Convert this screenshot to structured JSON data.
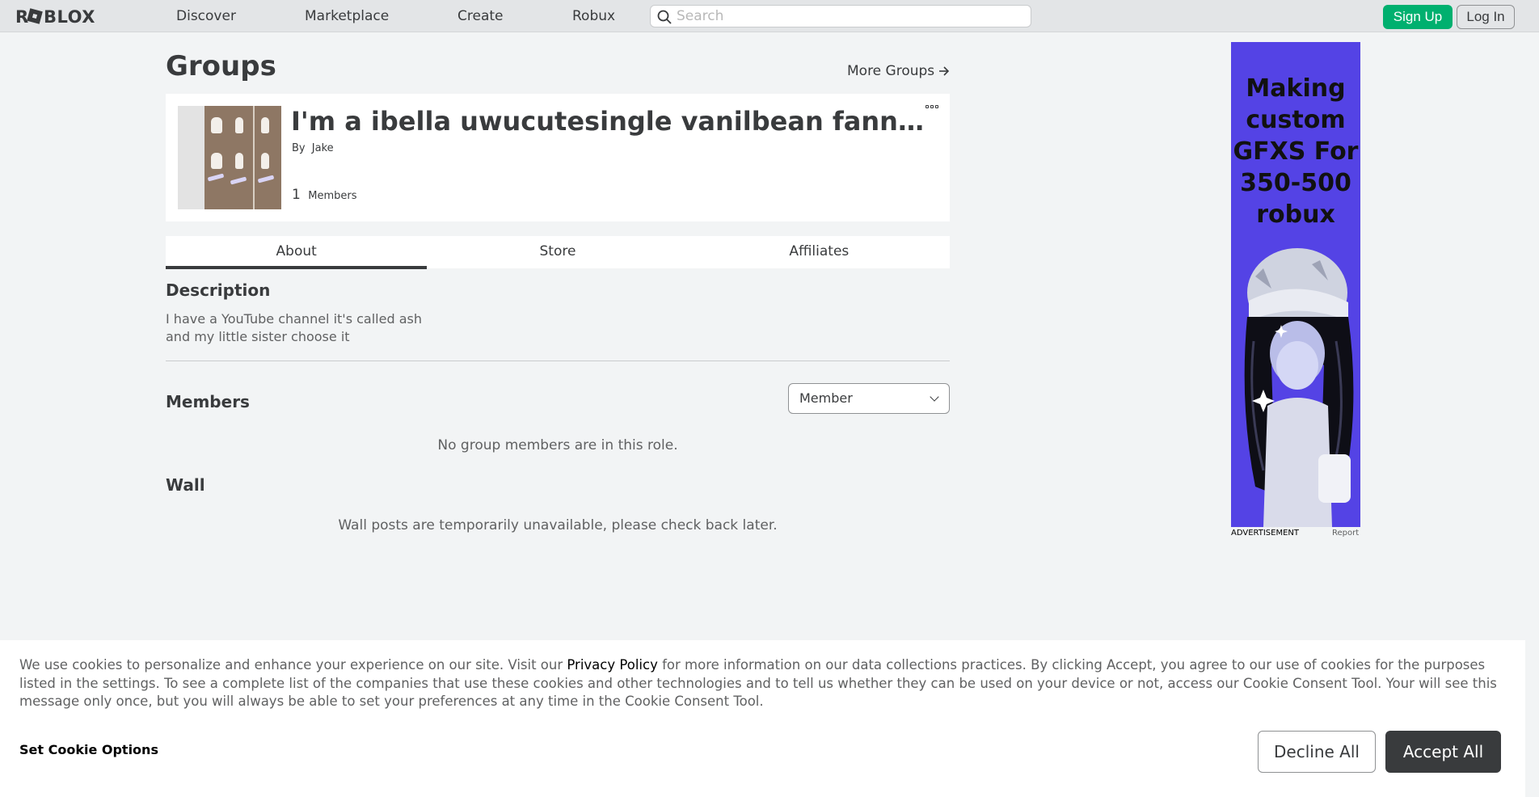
{
  "header": {
    "logo_text": "ROBLOX",
    "nav": [
      "Discover",
      "Marketplace",
      "Create",
      "Robux"
    ],
    "search_placeholder": "Search",
    "signup_label": "Sign Up",
    "login_label": "Log In"
  },
  "page": {
    "title": "Groups",
    "more_groups_label": "More Groups"
  },
  "group": {
    "name": "I'm a ibella uwucutesingle vanilbean fannnn...",
    "by_label": "By",
    "owner": "Jake",
    "member_count": "1",
    "members_label": "Members"
  },
  "tabs": [
    {
      "label": "About",
      "active": true
    },
    {
      "label": "Store",
      "active": false
    },
    {
      "label": "Affiliates",
      "active": false
    }
  ],
  "about": {
    "description_title": "Description",
    "description_text": "I have a YouTube channel it's called ash\nand my little sister choose it",
    "members_title": "Members",
    "role_selected": "Member",
    "members_empty": "No group members are in this role.",
    "wall_title": "Wall",
    "wall_message": "Wall posts are temporarily unavailable, please check back later."
  },
  "ad": {
    "text": "Making custom GFXS For 350-500 robux",
    "label": "ADVERTISEMENT",
    "report_label": "Report",
    "bg_color": "#5443e5"
  },
  "cookie": {
    "text_before": "We use cookies to personalize and enhance your experience on our site. Visit our ",
    "link_text": "Privacy Policy",
    "text_after": " for more information on our data collections practices. By clicking Accept, you agree to our use of cookies for the purposes listed in the settings. To see a complete list of the companies that use these cookies and other technologies and to tell us whether they can be used on your device or not, access our Cookie Consent Tool. Your will see this message only once, but you will always be able to set your preferences at any time in the Cookie Consent Tool.",
    "set_options_label": "Set Cookie Options",
    "decline_label": "Decline All",
    "accept_label": "Accept All"
  },
  "colors": {
    "signup_green": "#00b06f",
    "page_bg": "#f2f4f5",
    "accept_dark": "#393b3d"
  }
}
